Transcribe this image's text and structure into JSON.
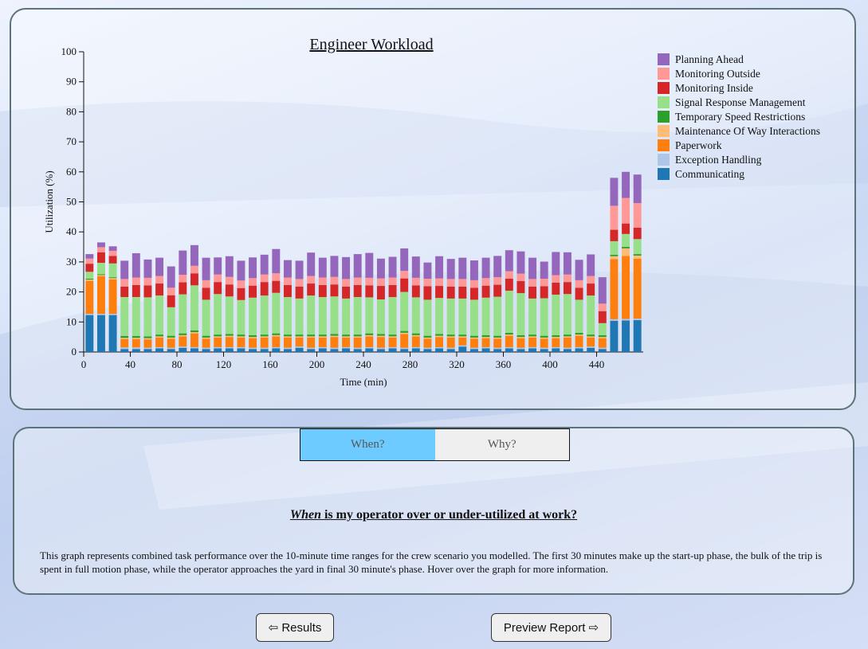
{
  "chart_data": {
    "type": "bar",
    "stacked": true,
    "title": "Engineer Workload",
    "xlabel": "Time (min)",
    "ylabel": "Utilization (%)",
    "ylim": [
      0,
      100
    ],
    "xlim": [
      0,
      480
    ],
    "yticks": [
      0,
      10,
      20,
      30,
      40,
      50,
      60,
      70,
      80,
      90,
      100
    ],
    "xticks": [
      0,
      40,
      80,
      120,
      160,
      200,
      240,
      280,
      320,
      360,
      400,
      440
    ],
    "x": [
      5,
      15,
      25,
      35,
      45,
      55,
      65,
      75,
      85,
      95,
      105,
      115,
      125,
      135,
      145,
      155,
      165,
      175,
      185,
      195,
      205,
      215,
      225,
      235,
      245,
      255,
      265,
      275,
      285,
      295,
      305,
      315,
      325,
      335,
      345,
      355,
      365,
      375,
      385,
      395,
      405,
      415,
      425,
      435,
      445,
      455,
      465,
      475
    ],
    "legend_position": "top-right",
    "series": [
      {
        "name": "Communicating",
        "color": "#1f77b4",
        "values": [
          12.3,
          12.3,
          12.3,
          1.0,
          1.0,
          1.0,
          1.2,
          1.0,
          1.4,
          1.2,
          1.0,
          1.2,
          1.2,
          1.2,
          1.0,
          1.0,
          1.2,
          1.0,
          1.4,
          1.0,
          1.2,
          1.0,
          1.2,
          1.0,
          1.2,
          1.0,
          1.2,
          1.0,
          1.2,
          1.0,
          1.2,
          1.0,
          1.8,
          1.0,
          1.2,
          1.0,
          1.2,
          1.0,
          1.2,
          1.0,
          1.2,
          1.0,
          1.2,
          1.4,
          1.0,
          10.4,
          10.5,
          10.6
        ]
      },
      {
        "name": "Exception Handling",
        "color": "#aec7e8",
        "values": [
          0.4,
          0.4,
          0.4,
          0.5,
          0.5,
          0.4,
          0.4,
          0.4,
          0.4,
          0.4,
          0.4,
          0.4,
          0.4,
          0.4,
          0.4,
          0.4,
          0.4,
          0.4,
          0.4,
          0.4,
          0.4,
          0.4,
          0.4,
          0.4,
          0.4,
          0.4,
          0.4,
          0.4,
          0.4,
          0.4,
          0.4,
          0.4,
          0.4,
          0.4,
          0.4,
          0.4,
          0.4,
          0.4,
          0.4,
          0.4,
          0.4,
          0.4,
          0.4,
          0.4,
          0.4,
          0.5,
          0.5,
          0.5
        ]
      },
      {
        "name": "Paperwork",
        "color": "#ff7f0e",
        "values": [
          11.0,
          12.5,
          11.5,
          2.8,
          2.8,
          2.8,
          3.2,
          3.0,
          3.4,
          4.6,
          3.0,
          3.2,
          3.4,
          3.2,
          3.2,
          3.4,
          3.6,
          3.4,
          3.0,
          3.4,
          3.2,
          3.6,
          3.2,
          3.4,
          3.6,
          3.6,
          3.2,
          4.6,
          3.6,
          3.0,
          3.4,
          3.4,
          2.6,
          3.0,
          3.0,
          3.0,
          3.8,
          3.2,
          3.2,
          3.0,
          3.0,
          3.4,
          3.8,
          3.0,
          3.2,
          20.0,
          21.0,
          20.0
        ]
      },
      {
        "name": "Maintenance Of Way Interactions",
        "color": "#ffbb78",
        "values": [
          0.4,
          0.4,
          0.4,
          0.4,
          0.4,
          0.4,
          0.4,
          0.4,
          0.4,
          0.4,
          0.4,
          0.4,
          0.4,
          0.4,
          0.4,
          0.4,
          0.4,
          0.4,
          0.4,
          0.4,
          0.4,
          0.4,
          0.4,
          0.4,
          0.4,
          0.4,
          0.4,
          0.4,
          0.4,
          0.4,
          0.4,
          0.4,
          0.4,
          0.4,
          0.4,
          0.4,
          0.4,
          0.4,
          0.4,
          0.4,
          0.4,
          0.4,
          0.4,
          0.4,
          0.4,
          1.0,
          2.5,
          1.0
        ]
      },
      {
        "name": "Temporary Speed Restrictions",
        "color": "#2ca02c",
        "values": [
          0.3,
          0.3,
          0.3,
          0.6,
          0.6,
          0.6,
          0.6,
          0.6,
          0.6,
          0.6,
          0.6,
          0.6,
          0.6,
          0.6,
          0.6,
          0.6,
          0.6,
          0.6,
          0.6,
          0.6,
          0.6,
          0.6,
          0.6,
          0.6,
          0.6,
          0.6,
          0.6,
          0.6,
          0.6,
          0.6,
          0.6,
          0.6,
          0.6,
          0.6,
          0.6,
          0.6,
          0.6,
          0.6,
          0.6,
          0.6,
          0.6,
          0.6,
          0.6,
          0.6,
          0.6,
          0.5,
          0.5,
          0.5
        ]
      },
      {
        "name": "Signal Response Management",
        "color": "#98df8a",
        "values": [
          2.3,
          3.8,
          4.6,
          13.0,
          13.0,
          13.0,
          13.0,
          9.5,
          13.0,
          15.0,
          12.0,
          13.5,
          12.5,
          11.5,
          12.5,
          13.0,
          13.5,
          12.5,
          12.0,
          13.0,
          12.5,
          12.5,
          12.0,
          12.5,
          12.0,
          11.5,
          12.5,
          13.0,
          12.0,
          12.0,
          12.0,
          12.0,
          12.0,
          12.0,
          12.5,
          13.0,
          14.0,
          14.0,
          12.0,
          12.5,
          13.5,
          13.5,
          11.0,
          13.0,
          4.0,
          4.5,
          4.3,
          5.0
        ]
      },
      {
        "name": "Monitoring Inside",
        "color": "#d62728",
        "values": [
          2.7,
          3.5,
          2.5,
          3.5,
          4.0,
          4.0,
          4.0,
          4.0,
          4.0,
          4.0,
          4.0,
          4.0,
          4.0,
          4.0,
          4.0,
          4.5,
          4.0,
          4.0,
          4.0,
          4.0,
          4.0,
          4.0,
          4.0,
          4.0,
          4.0,
          4.5,
          4.0,
          4.5,
          4.0,
          4.5,
          4.0,
          4.0,
          4.0,
          4.0,
          4.0,
          4.0,
          4.0,
          4.0,
          4.0,
          4.0,
          4.0,
          4.0,
          4.0,
          4.0,
          4.0,
          3.8,
          3.5,
          3.8
        ]
      },
      {
        "name": "Monitoring Outside",
        "color": "#ff9896",
        "values": [
          1.7,
          1.7,
          1.7,
          2.5,
          2.5,
          2.5,
          2.5,
          2.5,
          2.5,
          2.5,
          2.5,
          2.5,
          2.5,
          2.5,
          2.5,
          2.5,
          2.5,
          2.5,
          2.5,
          2.5,
          2.5,
          2.5,
          2.5,
          2.5,
          2.5,
          2.5,
          2.5,
          2.5,
          2.5,
          2.5,
          2.5,
          2.5,
          2.5,
          2.5,
          2.5,
          2.5,
          2.5,
          2.5,
          2.5,
          2.5,
          2.5,
          2.5,
          2.5,
          2.5,
          2.5,
          8.0,
          8.5,
          8.2
        ]
      },
      {
        "name": "Planning Ahead",
        "color": "#9467bd",
        "values": [
          1.5,
          1.6,
          1.5,
          6.1,
          8.1,
          6.1,
          6.1,
          7.1,
          8.1,
          6.9,
          7.5,
          5.7,
          6.9,
          6.6,
          6.9,
          6.6,
          8.1,
          5.8,
          6.1,
          7.8,
          6.6,
          7.0,
          7.3,
          7.8,
          8.3,
          6.6,
          6.9,
          7.5,
          7.1,
          5.4,
          7.4,
          6.7,
          7.1,
          6.6,
          6.8,
          7.1,
          7.0,
          7.4,
          7.1,
          5.7,
          7.7,
          7.4,
          6.8,
          7.2,
          8.8,
          9.3,
          8.7,
          9.5
        ]
      }
    ]
  },
  "tabs": [
    {
      "label": "When?"
    },
    {
      "label": "Why?"
    }
  ],
  "info": {
    "question_emph": "When",
    "question_rest": " is my operator over or under-utilized at work?",
    "description": "This graph represents combined task performance over the 10-minute time ranges for the crew scenario you modelled. The first 30 minutes make up the start-up phase, the bulk of the trip is spent in full motion phase, while the operator approaches the yard in final 30 minute's phase. Hover over the graph for more information."
  },
  "buttons": {
    "results": "⇦ Results",
    "preview": "Preview Report ⇨"
  }
}
